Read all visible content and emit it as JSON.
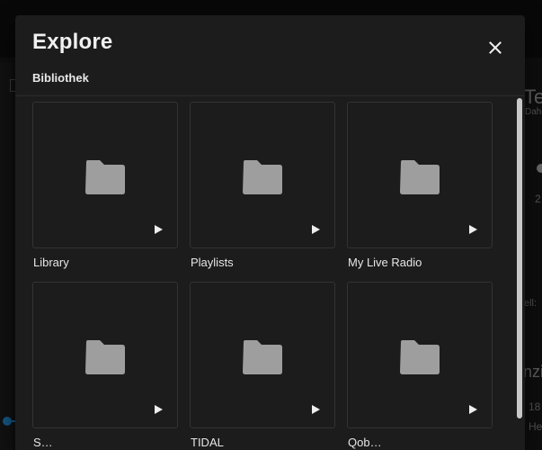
{
  "dialog": {
    "title": "Explore",
    "breadcrumb": "Bibliothek"
  },
  "tiles": [
    {
      "label": "Library"
    },
    {
      "label": "Playlists"
    },
    {
      "label": "My Live Radio"
    },
    {
      "label": "S…"
    },
    {
      "label": "TIDAL"
    },
    {
      "label": "Qob…"
    }
  ],
  "background": {
    "title_fragment": "Te",
    "subtitle_fragment": "Dahe",
    "number_fragment": "2",
    "label_fragment": "ell:",
    "heading_fragment": "nzi",
    "value_fragment": "18",
    "text_fragment": "He"
  },
  "icons": {
    "close": "close-icon",
    "folder": "folder-icon",
    "play": "play-icon"
  },
  "colors": {
    "dialog_bg": "#1c1c1c",
    "folder": "#9e9e9e",
    "accent": "#1e7fc0"
  }
}
